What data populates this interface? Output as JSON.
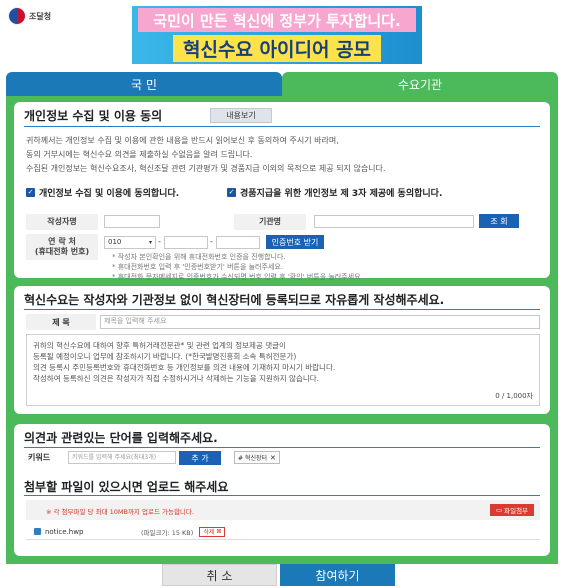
{
  "header": {
    "org_name": "조달청",
    "banner_top": "국민이 만든 혁신에 정부가 투자합니다.",
    "banner_main": "혁신수요 아이디어 공모"
  },
  "tabs": [
    {
      "label": "국 민",
      "active": false
    },
    {
      "label": "수요기관",
      "active": true
    }
  ],
  "privacy": {
    "title": "개인정보 수집 및 이용 동의",
    "view_label": "내용보기",
    "lines": [
      "귀하께서는 개인정보 수집 및 이용에 관한 내용을 반드시 읽어보신 후 동의하여 주시기 바라며,",
      "동의 거부시에는 혁신수요 의견을 제출하실 수없음을 알려 드립니다.",
      "수집된 개인정보는 혁신수요조사, 혁신조달 관련 기관평가 및 경품지급 이외의 목적으로 제공 되지 않습니다."
    ],
    "consent1": "개인정보 수집 및 이용에 동의합니다.",
    "consent2": "경품지급을 위한 개인정보 제 3자 제공에 동의합니다.",
    "writer_label": "작성자명",
    "agency_label": "기관명",
    "search_label": "조 회",
    "contact_label": "연 락 처",
    "contact_sub": "(휴대전화 번호)",
    "phone_prefix": "010",
    "dash": "-",
    "verify_label": "인증번호 받기",
    "notes": [
      "* 작성자 본인확인을 위해 휴대전화번호 인증을 진행합니다.",
      "* 휴대전화번호 입력 후 '인증번호받기' 버튼을 눌러주세요.",
      "* 휴대전화 문자메세지로 인증번호가 수신되면 번호 입력 후 '확인' 버튼을 눌러주세요"
    ]
  },
  "content": {
    "title": "혁신수요는 작성자와 기관정보 없이 혁신장터에 등록되므로 자유롭게 작성해주세요.",
    "subject_label": "제 목",
    "subject_placeholder": "제목을 입력해 주세요",
    "body_lines": [
      "귀하의 혁신수요에 대하여 향후 특허거래전문관* 및 관련 업계의 정보제공 댓글이",
      "등록될 예정이오니 업무에 참조하시기 바랍니다. (*한국발명진흥회 소속 특허전문가)",
      "의견 등록시 주민등록번호와 휴대전화번호 등 개인정보를 의견 내용에 기재하지 마시기 바랍니다.",
      "작성하여 등록하신 의견은 작성자가 직접 수정하시거나 삭제하는 기능을 지원하지 않습니다."
    ],
    "char_count": "0 / 1,000자"
  },
  "keywords": {
    "title": "의견과 관련있는 단어를 입력해주세요.",
    "label": "키워드",
    "placeholder": "키워드를 입력해 주세요(최대3개)",
    "add_label": "추 가",
    "chips": [
      "# 혁신장터"
    ]
  },
  "attachment": {
    "title": "첨부할 파일이 있으시면 업로드 해주세요",
    "note": "※ 각 첨부파일 당 최대 10MB까지 업로드 가능합니다.",
    "button_label": "파일첨부",
    "file_name": "notice.hwp",
    "file_size": "(파일크기: 15 KB)",
    "delete_label": "삭제"
  },
  "actions": {
    "cancel": "취 소",
    "submit": "참여하기"
  }
}
